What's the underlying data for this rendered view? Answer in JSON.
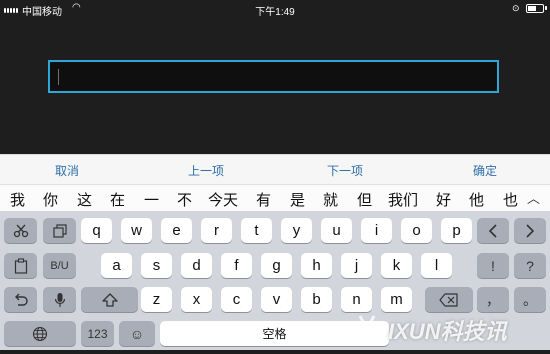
{
  "status_bar": {
    "carrier": "中国移动",
    "time": "下午1:49"
  },
  "input": {
    "value": ""
  },
  "toolbar": {
    "cancel": "取消",
    "prev": "上一项",
    "next": "下一项",
    "confirm": "确定"
  },
  "candidates": [
    "我",
    "你",
    "这",
    "在",
    "一",
    "不",
    "今天",
    "有",
    "是",
    "就",
    "但",
    "我们",
    "好",
    "他",
    "也"
  ],
  "keyboard": {
    "row1": [
      "q",
      "w",
      "e",
      "r",
      "t",
      "y",
      "u",
      "i",
      "o",
      "p"
    ],
    "row2": [
      "a",
      "s",
      "d",
      "f",
      "g",
      "h",
      "j",
      "k",
      "l"
    ],
    "row3": [
      "z",
      "x",
      "c",
      "v",
      "b",
      "n",
      "m"
    ],
    "format_label": "B/U",
    "num_label": "123",
    "space_label": "空格",
    "punct_exclaim": "!",
    "punct_question": "?",
    "punct_comma": "，",
    "punct_period": "。"
  },
  "watermark": "IXUN科技讯",
  "colors": {
    "accent": "#2ea6d8",
    "toolbar_text": "#2f6ea8",
    "keyboard_bg": "#d2d5db"
  }
}
